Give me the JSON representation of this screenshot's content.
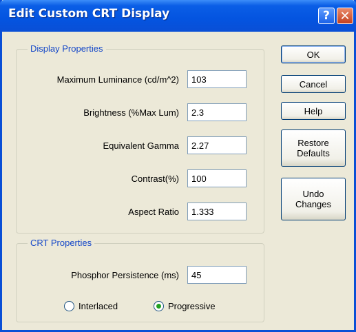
{
  "window": {
    "title": "Edit Custom CRT Display",
    "help_glyph": "?",
    "close_glyph": "✕"
  },
  "display_properties": {
    "title": "Display Properties",
    "max_luminance": {
      "label": "Maximum Luminance (cd/m^2)",
      "value": "103"
    },
    "brightness": {
      "label": "Brightness (%Max Lum)",
      "value": "2.3"
    },
    "gamma": {
      "label": "Equivalent Gamma",
      "value": "2.27"
    },
    "contrast": {
      "label": "Contrast(%)",
      "value": "100"
    },
    "aspect_ratio": {
      "label": "Aspect Ratio",
      "value": "1.333"
    }
  },
  "crt_properties": {
    "title": "CRT Properties",
    "phosphor": {
      "label": "Phosphor Persistence (ms)",
      "value": "45"
    },
    "scan_mode": {
      "interlaced_label": "Interlaced",
      "progressive_label": "Progressive",
      "selected": "Progressive"
    }
  },
  "buttons": {
    "ok": "OK",
    "cancel": "Cancel",
    "help": "Help",
    "restore": "Restore\nDefaults",
    "undo": "Undo\nChanges"
  },
  "colors": {
    "title_bar": "#0a5ee6",
    "group_title": "#1447c8",
    "dialog_bg": "#ece9d8",
    "radio_selected": "#21a121"
  }
}
